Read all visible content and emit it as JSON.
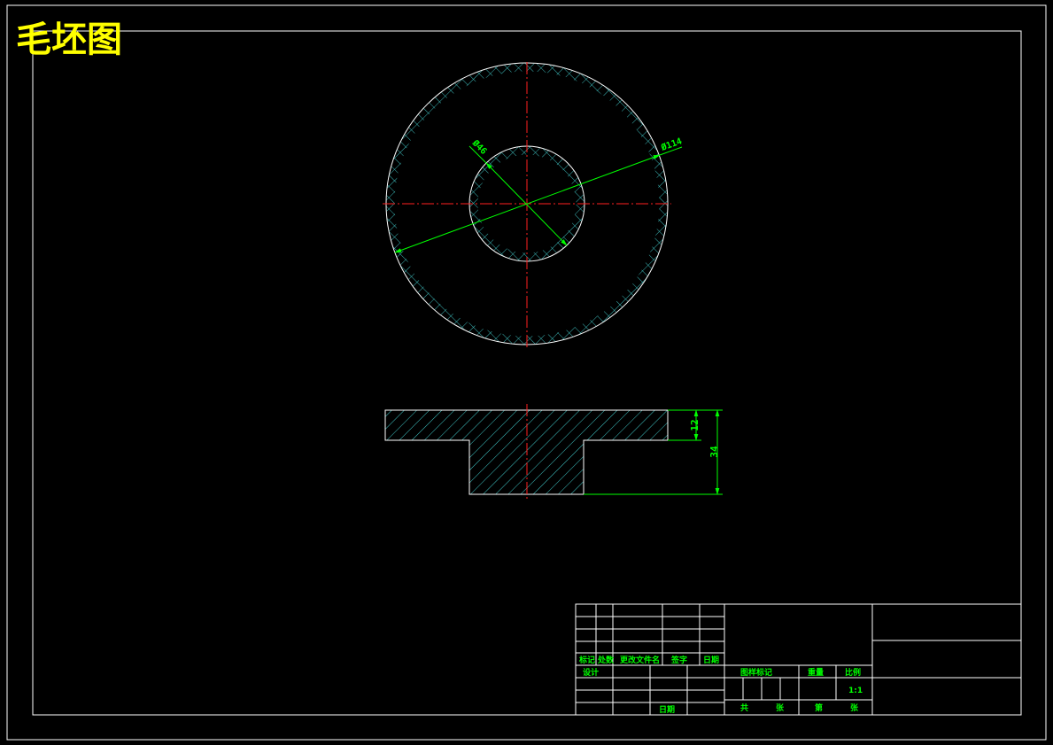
{
  "drawing": {
    "title": "毛坯图",
    "dimensions": {
      "outer_diameter": "Ø114",
      "inner_diameter": "Ø46",
      "flange_thickness": "12",
      "total_height": "34"
    }
  },
  "title_block": {
    "labels": {
      "mark": "标记",
      "count": "处数",
      "change_doc": "更改文件名",
      "signature": "签字",
      "date": "日期",
      "design": "设计",
      "review_date": "日期",
      "stage_mark": "图样标记",
      "weight": "重量",
      "scale": "比例",
      "total": "共",
      "sheets": "张",
      "sheet_no": "第",
      "sheet": "张"
    },
    "scale_value": "1:1"
  },
  "colors": {
    "background": "#000000",
    "outline": "#ffffff",
    "hatch": "#40c8c8",
    "dimension": "#00ff00",
    "centerline": "#ff2020",
    "title": "#ffff00"
  }
}
